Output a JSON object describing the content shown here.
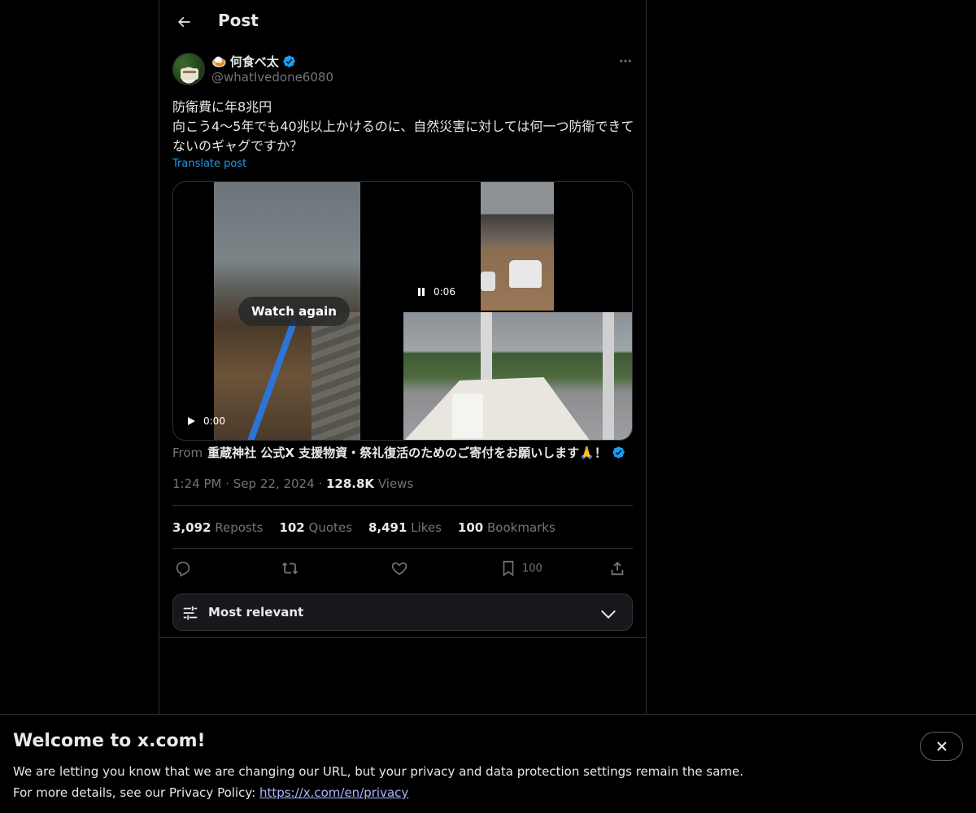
{
  "header": {
    "title": "Post",
    "back_icon": "arrow-left-icon"
  },
  "author": {
    "emoji": "🍛",
    "display_name": "何食べ太",
    "handle": "@whatIvedone6080",
    "verified": true
  },
  "tweet": {
    "text": "防衛費に年8兆円\n向こう4〜5年でも40兆以上かけるのに、自然災害に対しては何一つ防衛できてないのギャグですか？",
    "translate_label": "Translate post"
  },
  "media": {
    "watch_again_label": "Watch again",
    "video_top_time": "0:06",
    "video_bottom_time": "0:00"
  },
  "source": {
    "prefix": "From",
    "name": "重蔵神社 公式X 支援物資・祭礼復活のためのご寄付をお願いします🙏！"
  },
  "meta": {
    "time": "1:24 PM",
    "date": "Sep 22, 2024",
    "views_count": "128.8K",
    "views_label": "Views",
    "sep": "·"
  },
  "stats": {
    "reposts_count": "3,092",
    "reposts_label": "Reposts",
    "quotes_count": "102",
    "quotes_label": "Quotes",
    "likes_count": "8,491",
    "likes_label": "Likes",
    "bookmarks_count": "100",
    "bookmarks_label": "Bookmarks"
  },
  "actions": {
    "bookmark_count": "100"
  },
  "sort": {
    "label": "Most relevant"
  },
  "banner": {
    "title": "Welcome to x.com!",
    "line1": "We are letting you know that we are changing our URL, but your privacy and data protection settings remain the same.",
    "line2_prefix": "For more details, see our Privacy Policy: ",
    "link": "https://x.com/en/privacy"
  },
  "colors": {
    "accent": "#1d9bf0",
    "background": "#000000",
    "muted": "#71767b",
    "border": "#2f3336"
  }
}
